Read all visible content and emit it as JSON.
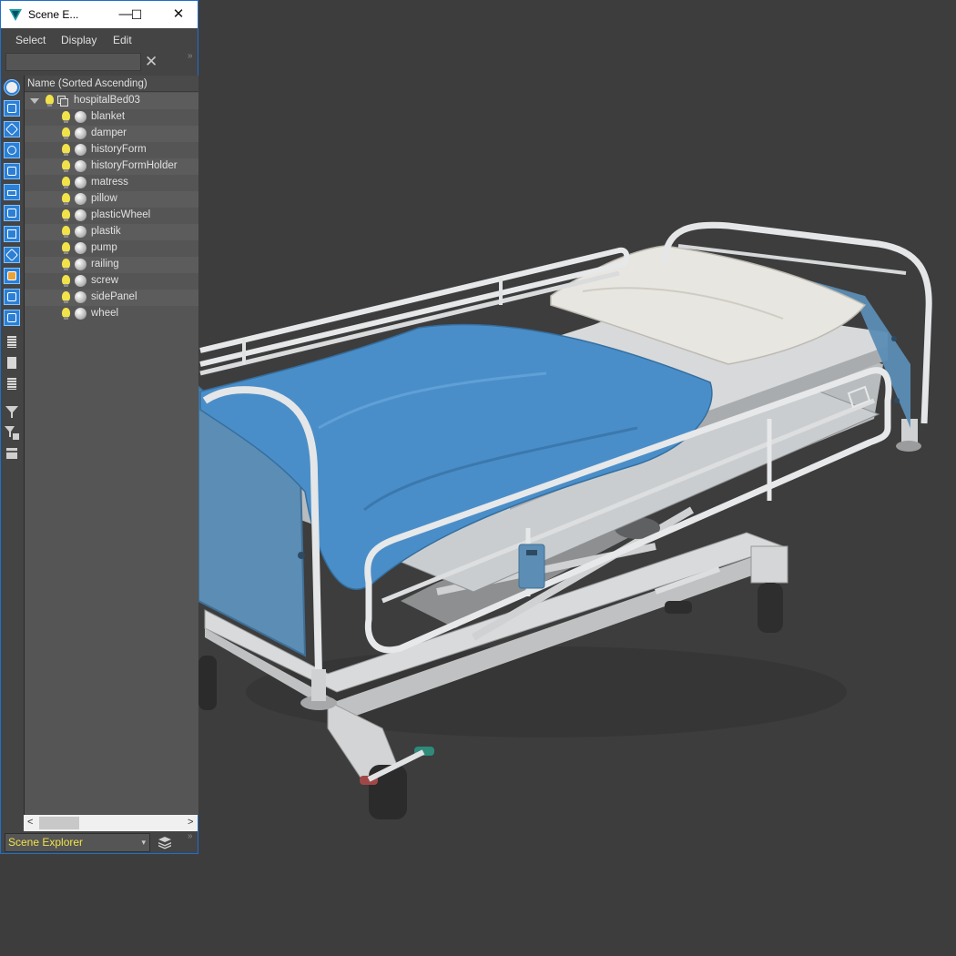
{
  "window": {
    "title": "Scene E...",
    "minimize": "—",
    "maximize": "☐",
    "close": "✕"
  },
  "menu": {
    "select": "Select",
    "display": "Display",
    "edit": "Edit"
  },
  "search": {
    "placeholder": "",
    "clear": "✕",
    "expander": "»"
  },
  "tree": {
    "header": "Name (Sorted Ascending)",
    "root": "hospitalBed03",
    "items": [
      "blanket",
      "damper",
      "historyForm",
      "historyFormHolder",
      "matress",
      "pillow",
      "plasticWheel",
      "plastik",
      "pump",
      "railing",
      "screw",
      "sidePanel",
      "wheel"
    ]
  },
  "scroll": {
    "left": "<",
    "right": ">"
  },
  "bottom": {
    "explorer_name": "Scene Explorer",
    "dropdown": "▾"
  },
  "colors": {
    "viewport_bg": "#3d3d3d",
    "panel_bg": "#555555",
    "blanket": "#4a8ec9",
    "frame": "#e4e6e7",
    "side_panel": "#5b8db5",
    "bulb": "#f2e24a"
  },
  "icons": [
    "app-3dsmax-icon",
    "display-none-icon",
    "display-geometry-icon",
    "display-shapes-icon",
    "display-lights-icon",
    "display-cameras-icon",
    "display-helpers-icon",
    "display-spacewarps-icon",
    "display-groups-icon",
    "display-xrefs-icon",
    "display-bones-icon",
    "display-containers-icon",
    "display-frozen-icon",
    "display-hidden-icon",
    "display-all-icon",
    "display-invert-icon",
    "filter-icon",
    "filter-options-icon",
    "layers-icon"
  ]
}
